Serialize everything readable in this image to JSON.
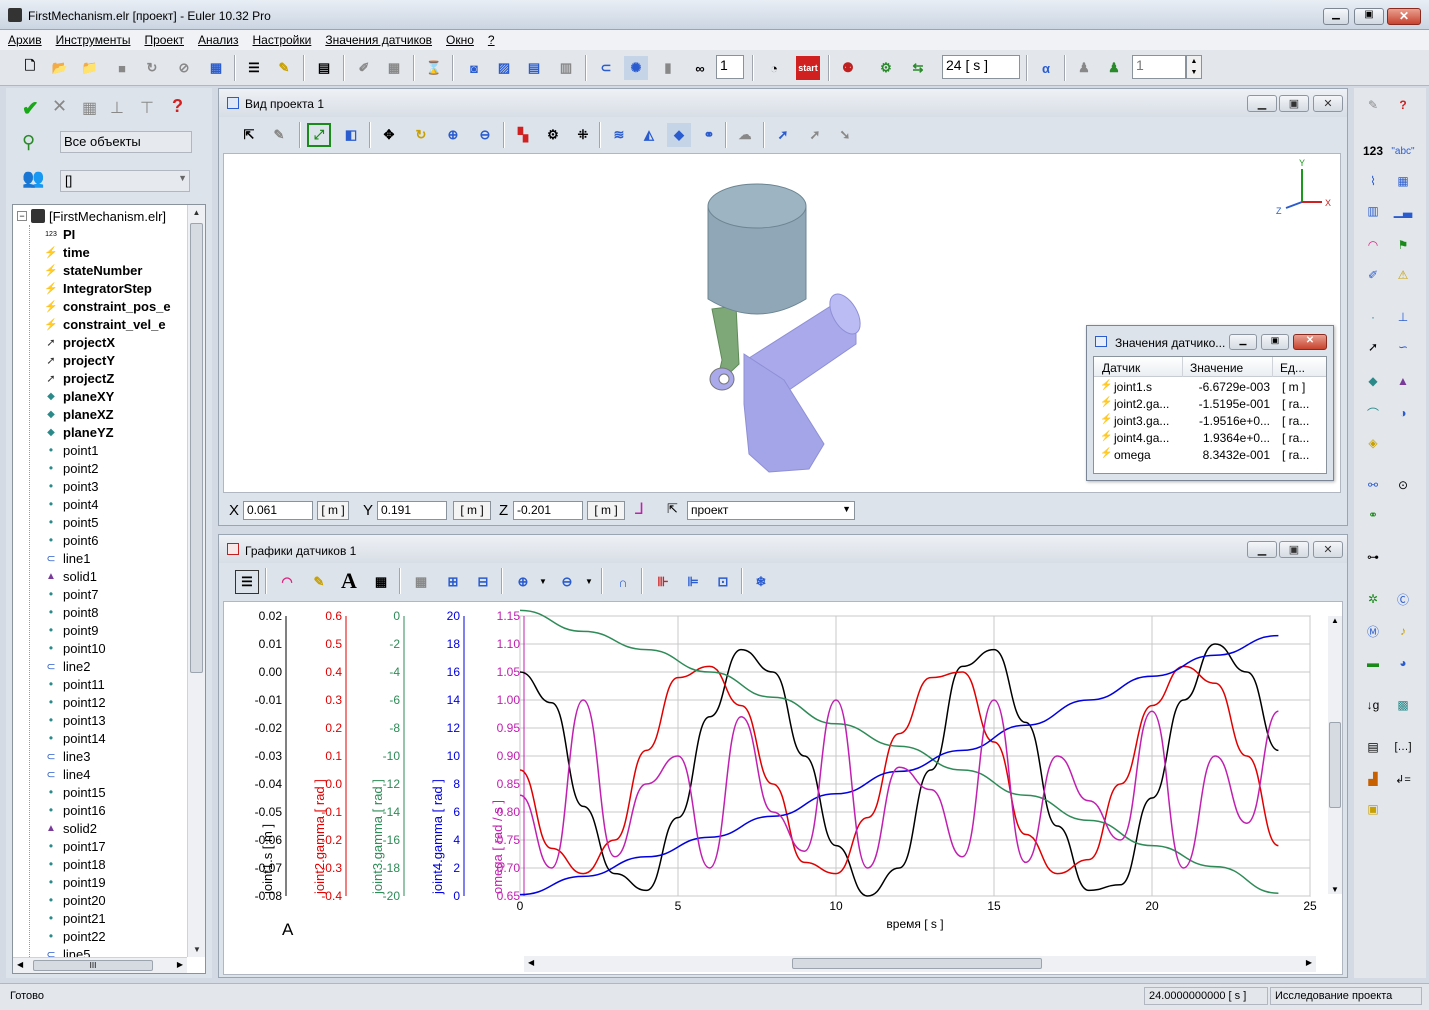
{
  "window": {
    "title": "FirstMechanism.elr [проект] - Euler 10.32 Pro"
  },
  "menu": [
    {
      "label": "Архив"
    },
    {
      "label": "Инструменты"
    },
    {
      "label": "Проект"
    },
    {
      "label": "Анализ"
    },
    {
      "label": "Настройки"
    },
    {
      "label": "Значения датчиков"
    },
    {
      "label": "Окно"
    },
    {
      "label": "?"
    }
  ],
  "toolbar": {
    "counter1": "1",
    "time_value": "24 [ s ]",
    "counter2": "1"
  },
  "left": {
    "filter_label": "Все объекты",
    "combo_value": "[]",
    "tree_root": "[FirstMechanism.elr]",
    "items": [
      {
        "label": "PI",
        "icon": "123-icon",
        "bold": true
      },
      {
        "label": "time",
        "icon": "sensor-icon",
        "bold": true
      },
      {
        "label": "stateNumber",
        "icon": "sensor-icon",
        "bold": true
      },
      {
        "label": "IntegratorStep",
        "icon": "sensor-icon",
        "bold": true
      },
      {
        "label": "constraint_pos_e",
        "icon": "sensor-icon",
        "bold": true
      },
      {
        "label": "constraint_vel_e",
        "icon": "sensor-icon",
        "bold": true
      },
      {
        "label": "projectX",
        "icon": "vector-icon",
        "bold": true
      },
      {
        "label": "projectY",
        "icon": "vector-icon",
        "bold": true
      },
      {
        "label": "projectZ",
        "icon": "vector-icon",
        "bold": true
      },
      {
        "label": "planeXY",
        "icon": "plane-icon",
        "bold": true
      },
      {
        "label": "planeXZ",
        "icon": "plane-icon",
        "bold": true
      },
      {
        "label": "planeYZ",
        "icon": "plane-icon",
        "bold": true
      },
      {
        "label": "point1",
        "icon": "point-icon",
        "bold": false
      },
      {
        "label": "point2",
        "icon": "point-icon",
        "bold": false
      },
      {
        "label": "point3",
        "icon": "point-icon",
        "bold": false
      },
      {
        "label": "point4",
        "icon": "point-icon",
        "bold": false
      },
      {
        "label": "point5",
        "icon": "point-icon",
        "bold": false
      },
      {
        "label": "point6",
        "icon": "point-icon",
        "bold": false
      },
      {
        "label": "line1",
        "icon": "line-icon",
        "bold": false
      },
      {
        "label": "solid1",
        "icon": "solid-icon",
        "bold": false
      },
      {
        "label": "point7",
        "icon": "point-icon",
        "bold": false
      },
      {
        "label": "point8",
        "icon": "point-icon",
        "bold": false
      },
      {
        "label": "point9",
        "icon": "point-icon",
        "bold": false
      },
      {
        "label": "point10",
        "icon": "point-icon",
        "bold": false
      },
      {
        "label": "line2",
        "icon": "line-icon",
        "bold": false
      },
      {
        "label": "point11",
        "icon": "point-icon",
        "bold": false
      },
      {
        "label": "point12",
        "icon": "point-icon",
        "bold": false
      },
      {
        "label": "point13",
        "icon": "point-icon",
        "bold": false
      },
      {
        "label": "point14",
        "icon": "point-icon",
        "bold": false
      },
      {
        "label": "line3",
        "icon": "line-icon",
        "bold": false
      },
      {
        "label": "line4",
        "icon": "line-icon",
        "bold": false
      },
      {
        "label": "point15",
        "icon": "point-icon",
        "bold": false
      },
      {
        "label": "point16",
        "icon": "point-icon",
        "bold": false
      },
      {
        "label": "solid2",
        "icon": "solid-icon",
        "bold": false
      },
      {
        "label": "point17",
        "icon": "point-icon",
        "bold": false
      },
      {
        "label": "point18",
        "icon": "point-icon",
        "bold": false
      },
      {
        "label": "point19",
        "icon": "point-icon",
        "bold": false
      },
      {
        "label": "point20",
        "icon": "point-icon",
        "bold": false
      },
      {
        "label": "point21",
        "icon": "point-icon",
        "bold": false
      },
      {
        "label": "point22",
        "icon": "point-icon",
        "bold": false
      },
      {
        "label": "line5",
        "icon": "line-icon",
        "bold": false
      }
    ]
  },
  "view": {
    "title": "Вид проекта 1",
    "x_label": "X",
    "x_value": "0.061",
    "y_label": "Y",
    "y_value": "0.191",
    "z_label": "Z",
    "z_value": "-0.201",
    "unit": "[ m ]",
    "frame": "проект",
    "axes": {
      "y": "Y",
      "x": "X",
      "z": "Z"
    }
  },
  "sensors": {
    "title": "Значения датчико...",
    "headers": [
      "Датчик",
      "Значение",
      "Ед..."
    ],
    "rows": [
      {
        "name": "joint1.s",
        "value": "-6.6729e-003",
        "unit": "[ m ]"
      },
      {
        "name": "joint2.ga...",
        "value": "-1.5195e-001",
        "unit": "[ ra..."
      },
      {
        "name": "joint3.ga...",
        "value": "-1.9516e+0...",
        "unit": "[ ra..."
      },
      {
        "name": "joint4.ga...",
        "value": "1.9364e+0...",
        "unit": "[ ra..."
      },
      {
        "name": "omega",
        "value": "8.3432e-001",
        "unit": "[ ra..."
      }
    ]
  },
  "graph": {
    "title": "Графики датчиков 1",
    "anno": "A"
  },
  "status": {
    "left": "Готово",
    "time": "24.0000000000 [ s ]",
    "mode": "Исследование проекта"
  },
  "chart_data": {
    "type": "line",
    "xlabel": "время   [ s ]",
    "xlim": [
      0,
      25
    ],
    "xticks": [
      0,
      5,
      10,
      15,
      20,
      25
    ],
    "axes": [
      {
        "label": "joint1.s   [ m ]",
        "color": "#000000",
        "ticks": [
          "0.02",
          "0.01",
          "0.00",
          "-0.01",
          "-0.02",
          "-0.03",
          "-0.04",
          "-0.05",
          "-0.06",
          "-0.07",
          "-0.08"
        ],
        "ylim": [
          -0.08,
          0.02
        ]
      },
      {
        "label": "joint2.gamma   [ rad ]",
        "color": "#e00000",
        "ticks": [
          "0.6",
          "0.5",
          "0.4",
          "0.3",
          "0.2",
          "0.1",
          "0.0",
          "-0.1",
          "-0.2",
          "-0.3",
          "-0.4"
        ],
        "ylim": [
          -0.4,
          0.6
        ]
      },
      {
        "label": "joint3.gamma   [ rad ]",
        "color": "#2e8b57",
        "ticks": [
          "0",
          "-2",
          "-4",
          "-6",
          "-8",
          "-10",
          "-12",
          "-14",
          "-16",
          "-18",
          "-20"
        ],
        "ylim": [
          -20,
          0
        ]
      },
      {
        "label": "joint4.gamma   [ rad ]",
        "color": "#0000e0",
        "ticks": [
          "20",
          "18",
          "16",
          "14",
          "12",
          "10",
          "8",
          "6",
          "4",
          "2",
          "0"
        ],
        "ylim": [
          0,
          20
        ]
      },
      {
        "label": "omega   [ rad / s ]",
        "color": "#c020b0",
        "ticks": [
          "1.15",
          "1.10",
          "1.05",
          "1.00",
          "0.95",
          "0.90",
          "0.85",
          "0.80",
          "0.75",
          "0.70",
          "0.65"
        ],
        "ylim": [
          0.65,
          1.15
        ]
      }
    ],
    "series": [
      {
        "axis": 0,
        "color": "#000000",
        "x": [
          0,
          1,
          2,
          3,
          4,
          5,
          6,
          7,
          8,
          9,
          10,
          11,
          12,
          13,
          14,
          15,
          16,
          17,
          18,
          19,
          20,
          21,
          22,
          23,
          24
        ],
        "y": [
          0.0,
          -0.011,
          -0.048,
          -0.072,
          -0.078,
          -0.052,
          -0.016,
          0.008,
          0.0,
          -0.03,
          -0.062,
          -0.08,
          -0.07,
          -0.035,
          0.002,
          0.008,
          -0.018,
          -0.055,
          -0.078,
          -0.076,
          -0.045,
          -0.01,
          0.01,
          0.0,
          -0.028
        ]
      },
      {
        "axis": 1,
        "color": "#e00000",
        "x": [
          0,
          1,
          2,
          3,
          4,
          5,
          6,
          7,
          8,
          9,
          10,
          11,
          12,
          13,
          14,
          15,
          16,
          17,
          18,
          19,
          20,
          21,
          22,
          23,
          24
        ],
        "y": [
          0.05,
          -0.23,
          -0.32,
          -0.2,
          0.12,
          0.38,
          0.42,
          0.28,
          0.0,
          -0.28,
          -0.32,
          -0.12,
          0.18,
          0.38,
          0.4,
          0.15,
          -0.18,
          -0.32,
          -0.27,
          0.0,
          0.28,
          0.42,
          0.36,
          0.1,
          -0.22
        ]
      },
      {
        "axis": 2,
        "color": "#2e8b57",
        "x": [
          0,
          2,
          4,
          6,
          8,
          10,
          12,
          14,
          16,
          18,
          20,
          22,
          24
        ],
        "y": [
          0.4,
          -1.1,
          -2.4,
          -4.0,
          -5.8,
          -7.7,
          -9.3,
          -11.0,
          -12.8,
          -14.6,
          -16.4,
          -17.9,
          -19.8
        ]
      },
      {
        "axis": 3,
        "color": "#0000e0",
        "x": [
          0,
          2,
          4,
          6,
          8,
          10,
          12,
          14,
          16,
          18,
          20,
          22,
          24
        ],
        "y": [
          0.1,
          1.4,
          2.8,
          4.2,
          5.7,
          7.3,
          8.9,
          10.4,
          12.2,
          14.0,
          15.7,
          17.2,
          18.6
        ]
      },
      {
        "axis": 4,
        "color": "#c020b0",
        "x": [
          0,
          1,
          2,
          3,
          4,
          5,
          6,
          7,
          8,
          9,
          10,
          11,
          12,
          13,
          14,
          15,
          16,
          17,
          18,
          19,
          20,
          21,
          22,
          23,
          24
        ],
        "y": [
          0.83,
          0.7,
          1.0,
          0.72,
          0.85,
          0.9,
          0.7,
          0.97,
          0.8,
          0.73,
          1.0,
          0.7,
          0.88,
          0.84,
          0.72,
          1.0,
          0.71,
          0.9,
          0.82,
          0.75,
          0.98,
          0.7,
          0.9,
          0.78,
          0.98
        ]
      }
    ]
  },
  "colors": {
    "chrome": "#d4dae3",
    "title_bar": "#e8ecf1",
    "panel": "#ffffff"
  }
}
